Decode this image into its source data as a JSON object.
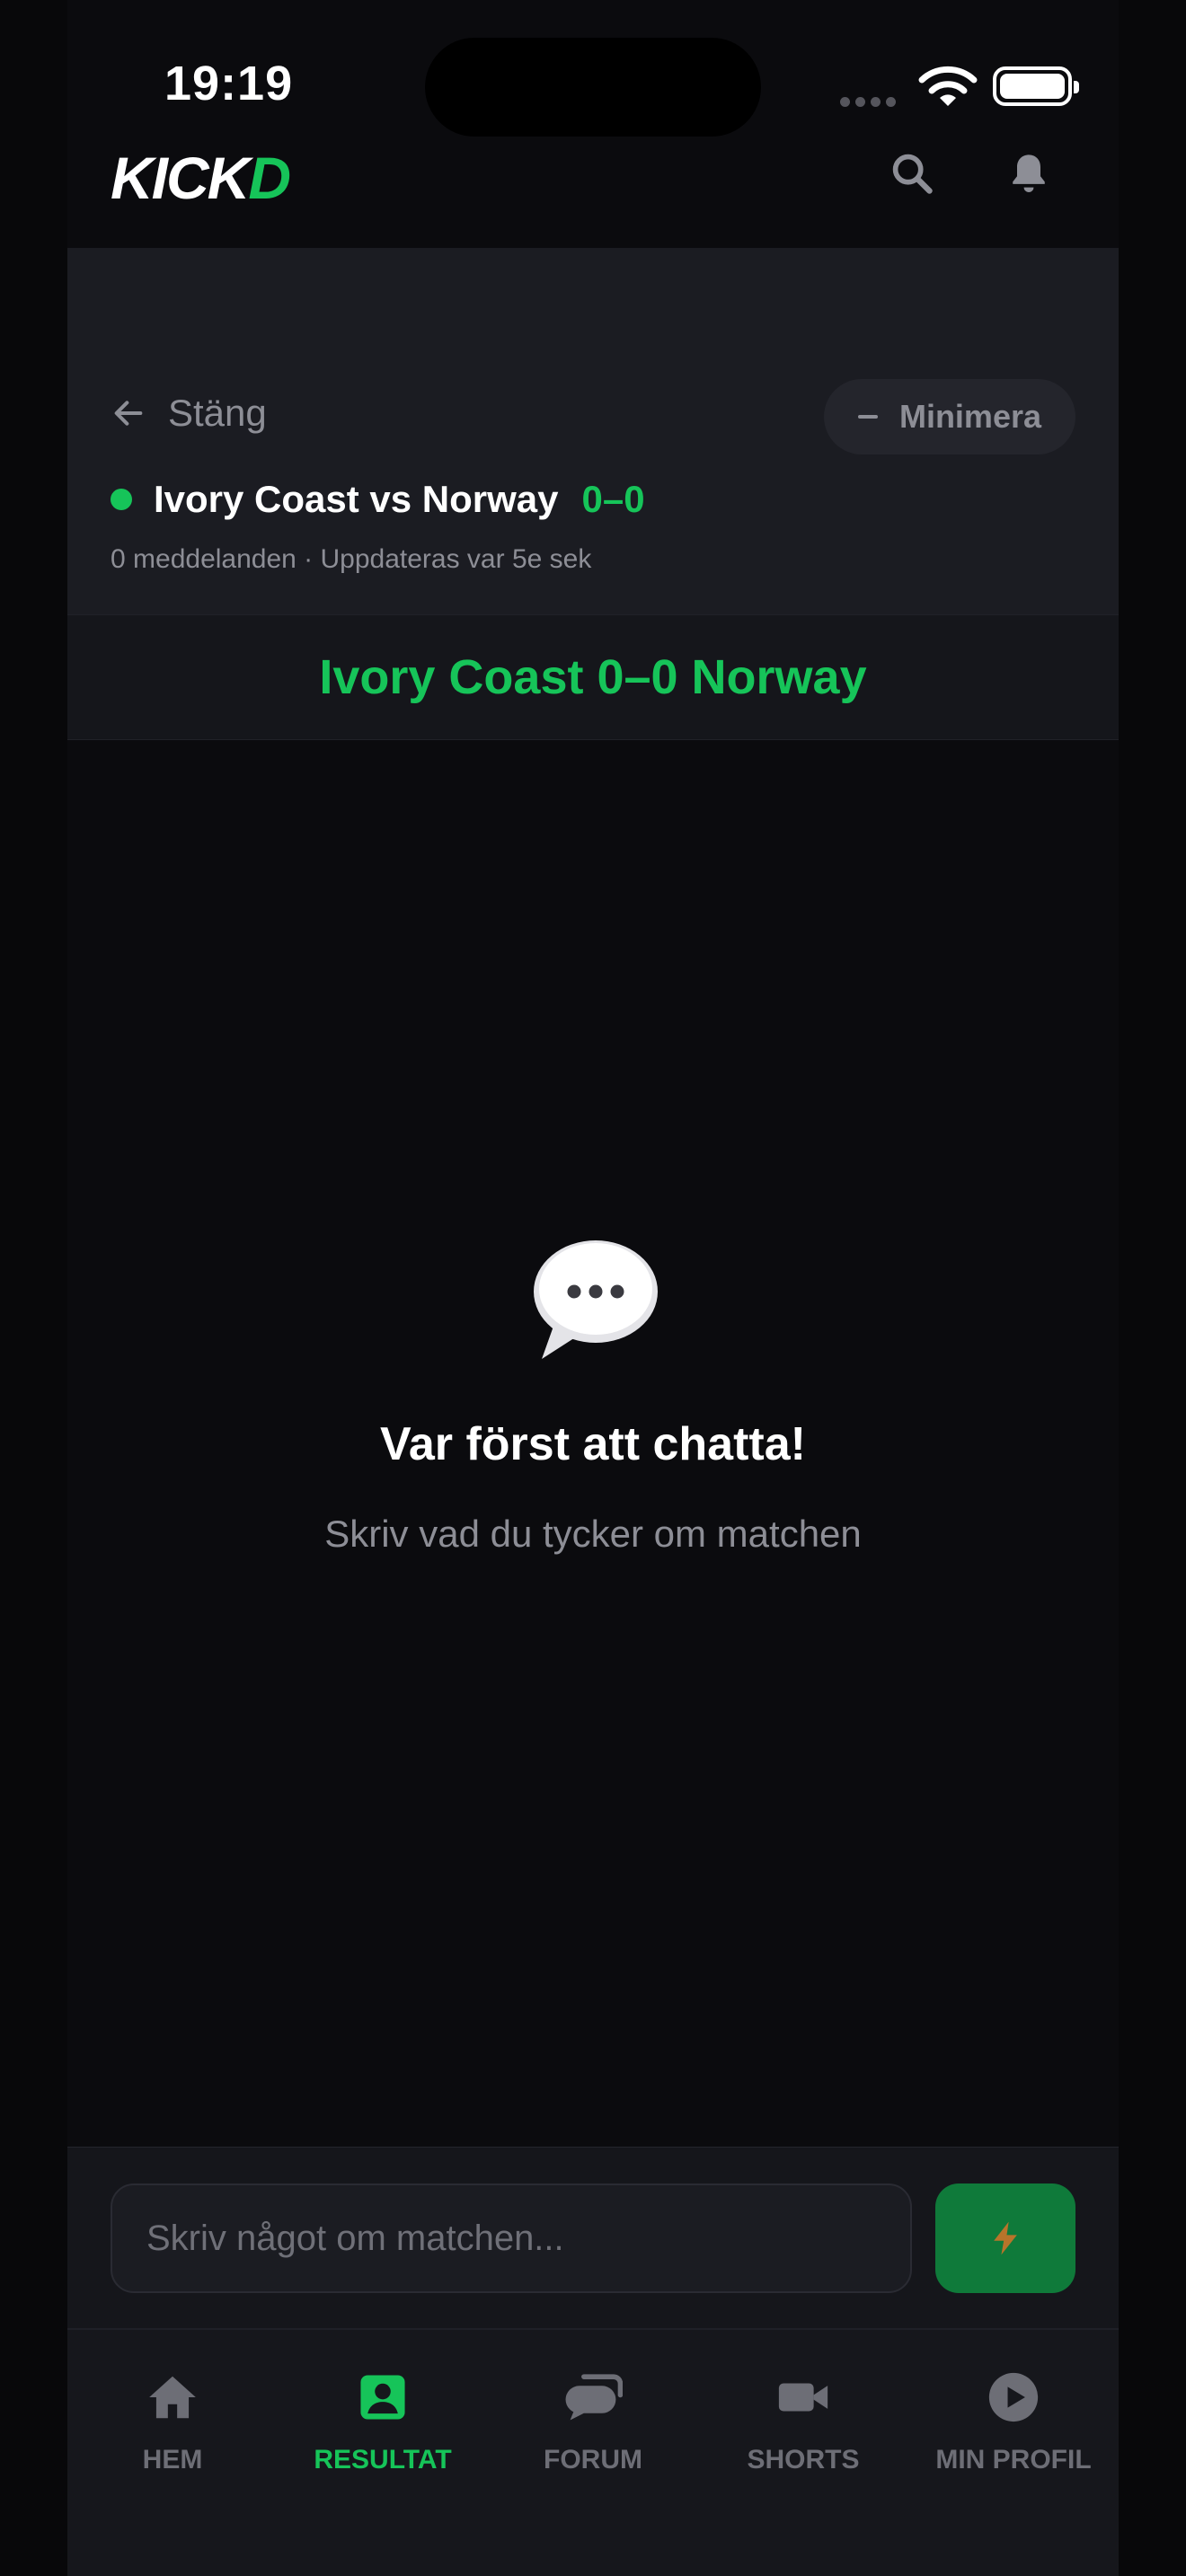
{
  "status_bar": {
    "time": "19:19"
  },
  "brand": {
    "logo_main": "KICK",
    "logo_accent": "D",
    "accent_color": "#16c459"
  },
  "header": {
    "icons": [
      "search-icon",
      "bell-icon"
    ]
  },
  "chat_panel": {
    "close_label": "Stäng",
    "minimize_label": "Minimera",
    "match_title": "Ivory Coast vs Norway",
    "match_score": "0–0",
    "meta": "0 meddelanden · Uppdateras var 5e sek",
    "score_banner": "Ivory Coast 0–0 Norway"
  },
  "empty_state": {
    "icon": "speech-bubble-icon",
    "title": "Var först att chatta!",
    "subtitle": "Skriv vad du tycker om matchen"
  },
  "composer": {
    "placeholder": "Skriv något om matchen...",
    "send_icon": "lightning-icon"
  },
  "tabs": [
    {
      "label": "HEM",
      "icon": "home-icon",
      "active": false
    },
    {
      "label": "RESULTAT",
      "icon": "results-icon",
      "active": true
    },
    {
      "label": "FORUM",
      "icon": "forum-icon",
      "active": false
    },
    {
      "label": "SHORTS",
      "icon": "video-icon",
      "active": false
    },
    {
      "label": "MIN PROFIL",
      "icon": "play-icon",
      "active": false
    }
  ]
}
